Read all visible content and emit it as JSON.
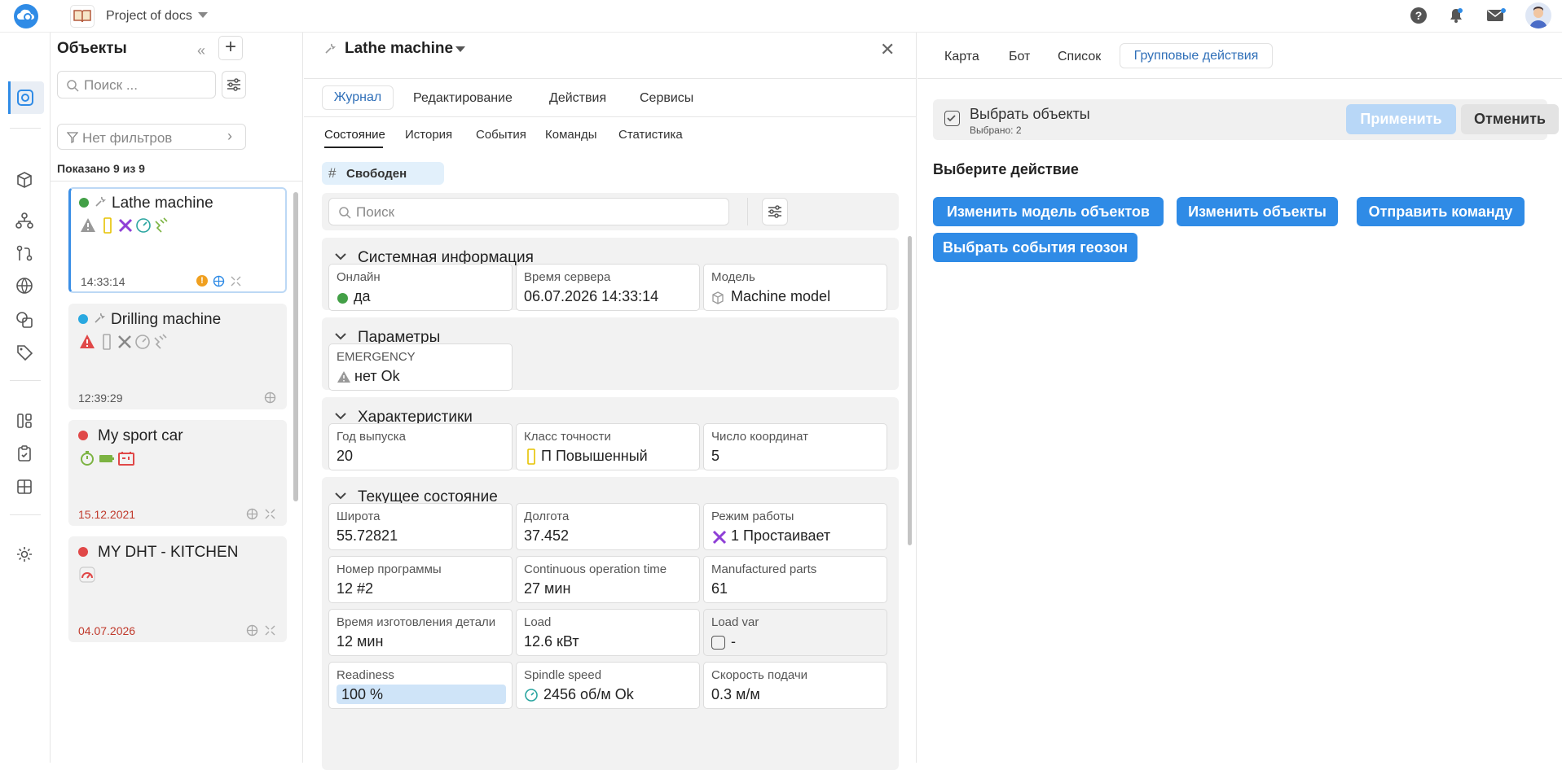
{
  "app": {
    "project_name": "Project of docs"
  },
  "objects_panel": {
    "title": "Объекты",
    "search_placeholder": "Поиск ...",
    "filter_label": "Нет фильтров",
    "shown_count": "Показано 9 из 9",
    "items": [
      {
        "name": "Lathe machine",
        "time": "14:33:14",
        "status_color": "#43a047"
      },
      {
        "name": "Drilling machine",
        "time": "12:39:29",
        "status_color": "#29a8e0"
      },
      {
        "name": "My sport car",
        "time": "15.12.2021",
        "status_color": "#e04848"
      },
      {
        "name": "MY DHT - KITCHEN",
        "time": "04.07.2026",
        "status_color": "#e04848"
      }
    ]
  },
  "detail": {
    "title": "Lathe machine",
    "tabs": [
      "Журнал",
      "Редактирование",
      "Действия",
      "Сервисы"
    ],
    "subtabs": [
      "Состояние",
      "История",
      "События",
      "Команды",
      "Статистика"
    ],
    "tag": "Свободен",
    "search_placeholder": "Поиск",
    "sections": {
      "system": {
        "title": "Системная информация",
        "cells": [
          {
            "label": "Онлайн",
            "value": "да"
          },
          {
            "label": "Время сервера",
            "value": "06.07.2026 14:33:14"
          },
          {
            "label": "Модель",
            "value": "Machine model"
          }
        ]
      },
      "params": {
        "title": "Параметры",
        "cells": [
          {
            "label": "EMERGENCY",
            "value": "нет Ok"
          }
        ]
      },
      "specs": {
        "title": "Характеристики",
        "cells": [
          {
            "label": "Год выпуска",
            "value": "20"
          },
          {
            "label": "Класс точности",
            "value": "П Повышенный"
          },
          {
            "label": "Число координат",
            "value": "5"
          }
        ]
      },
      "current": {
        "title": "Текущее состояние",
        "cells": [
          {
            "label": "Широта",
            "value": "55.72821"
          },
          {
            "label": "Долгота",
            "value": "37.452"
          },
          {
            "label": "Режим работы",
            "value": "1 Простаивает"
          },
          {
            "label": "Номер программы",
            "value": "12 #2"
          },
          {
            "label": "Continuous operation time",
            "value": "27 мин"
          },
          {
            "label": "Manufactured parts",
            "value": "61"
          },
          {
            "label": "Время изготовления детали",
            "value": "12 мин"
          },
          {
            "label": "Load",
            "value": "12.6 кВт"
          },
          {
            "label": "Load var",
            "value": "-"
          },
          {
            "label": "Readiness",
            "value": "100 %"
          },
          {
            "label": "Spindle speed",
            "value": "2456 об/м Ok"
          },
          {
            "label": "Скорость подачи",
            "value": "0.3 м/м"
          }
        ]
      }
    }
  },
  "right": {
    "tabs": [
      "Карта",
      "Бот",
      "Список",
      "Групповые действия"
    ],
    "select_title": "Выбрать объекты",
    "selected_count": "Выбрано: 2",
    "apply_label": "Применить",
    "cancel_label": "Отменить",
    "choose_action": "Выберите действие",
    "actions": [
      "Изменить модель объектов",
      "Изменить объекты",
      "Отправить команду",
      "Выбрать события геозон"
    ]
  },
  "colors": {
    "accent": "#2f8be6",
    "accent_light": "#b8d7f7",
    "online_green": "#43a047",
    "warning_orange": "#f0a020",
    "purple_tool": "#8e3fd6"
  }
}
